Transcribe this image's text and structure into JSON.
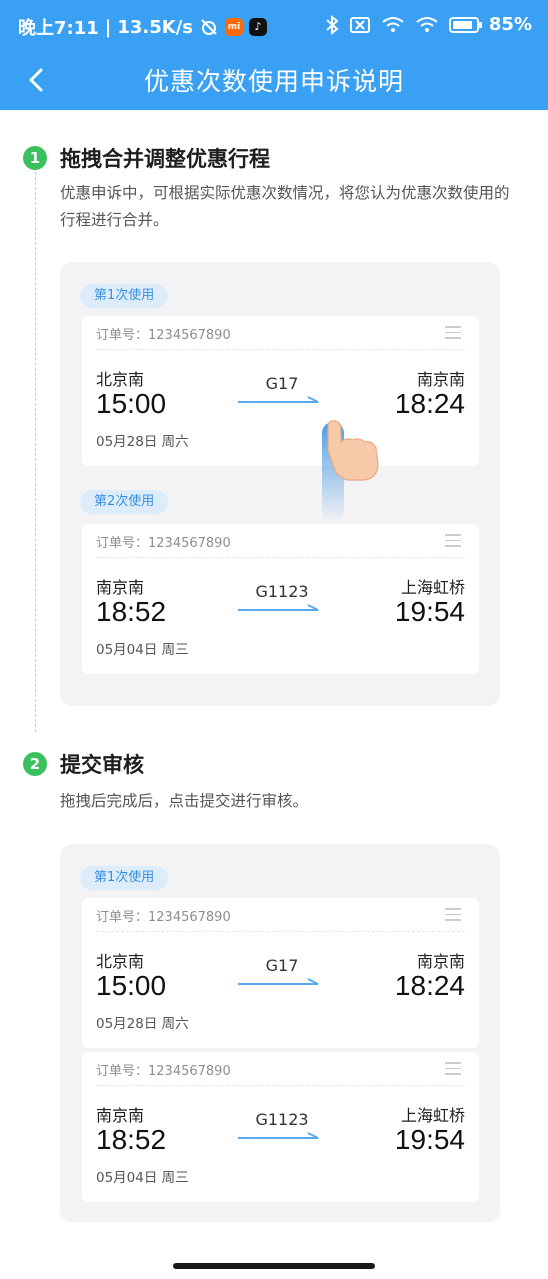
{
  "status_bar": {
    "time": "晚上7:11",
    "network_speed": "13.5K/s",
    "battery_level": "85%",
    "battery_fraction": 0.85
  },
  "header": {
    "title": "优惠次数使用申诉说明"
  },
  "steps": [
    {
      "number": "1",
      "title": "拖拽合并调整优惠行程",
      "description": "优惠申诉中，可根据实际优惠次数情况，将您认为优惠次数使用的行程进行合并。",
      "cards": [
        {
          "tag": "第1次使用",
          "order": "订单号：1234567890",
          "from_station": "北京南",
          "from_time": "15:00",
          "date": "05月28日  周六",
          "train_no": "G17",
          "to_station": "南京南",
          "to_time": "18:24"
        },
        {
          "tag": "第2次使用",
          "order": "订单号：1234567890",
          "from_station": "南京南",
          "from_time": "18:52",
          "date": "05月04日  周三",
          "train_no": "G1123",
          "to_station": "上海虹桥",
          "to_time": "19:54"
        }
      ]
    },
    {
      "number": "2",
      "title": "提交审核",
      "description": "拖拽后完成后，点击提交进行审核。",
      "tag": "第1次使用",
      "cards": [
        {
          "order": "订单号：1234567890",
          "from_station": "北京南",
          "from_time": "15:00",
          "date": "05月28日  周六",
          "train_no": "G17",
          "to_station": "南京南",
          "to_time": "18:24"
        },
        {
          "order": "订单号：1234567890",
          "from_station": "南京南",
          "from_time": "18:52",
          "date": "05月04日  周三",
          "train_no": "G1123",
          "to_station": "上海虹桥",
          "to_time": "19:54"
        }
      ]
    }
  ],
  "colors": {
    "header_bg": "#3aa0f3",
    "step_green": "#3bc05e",
    "tag_bg": "#dcecfb",
    "tag_text": "#3a8fe0",
    "panel_bg": "#f3f3f5"
  },
  "icons": {
    "back": "chevron-left-icon",
    "drag_hint": "hand-drag-icon",
    "card_menu": "drag-handle-icon"
  }
}
